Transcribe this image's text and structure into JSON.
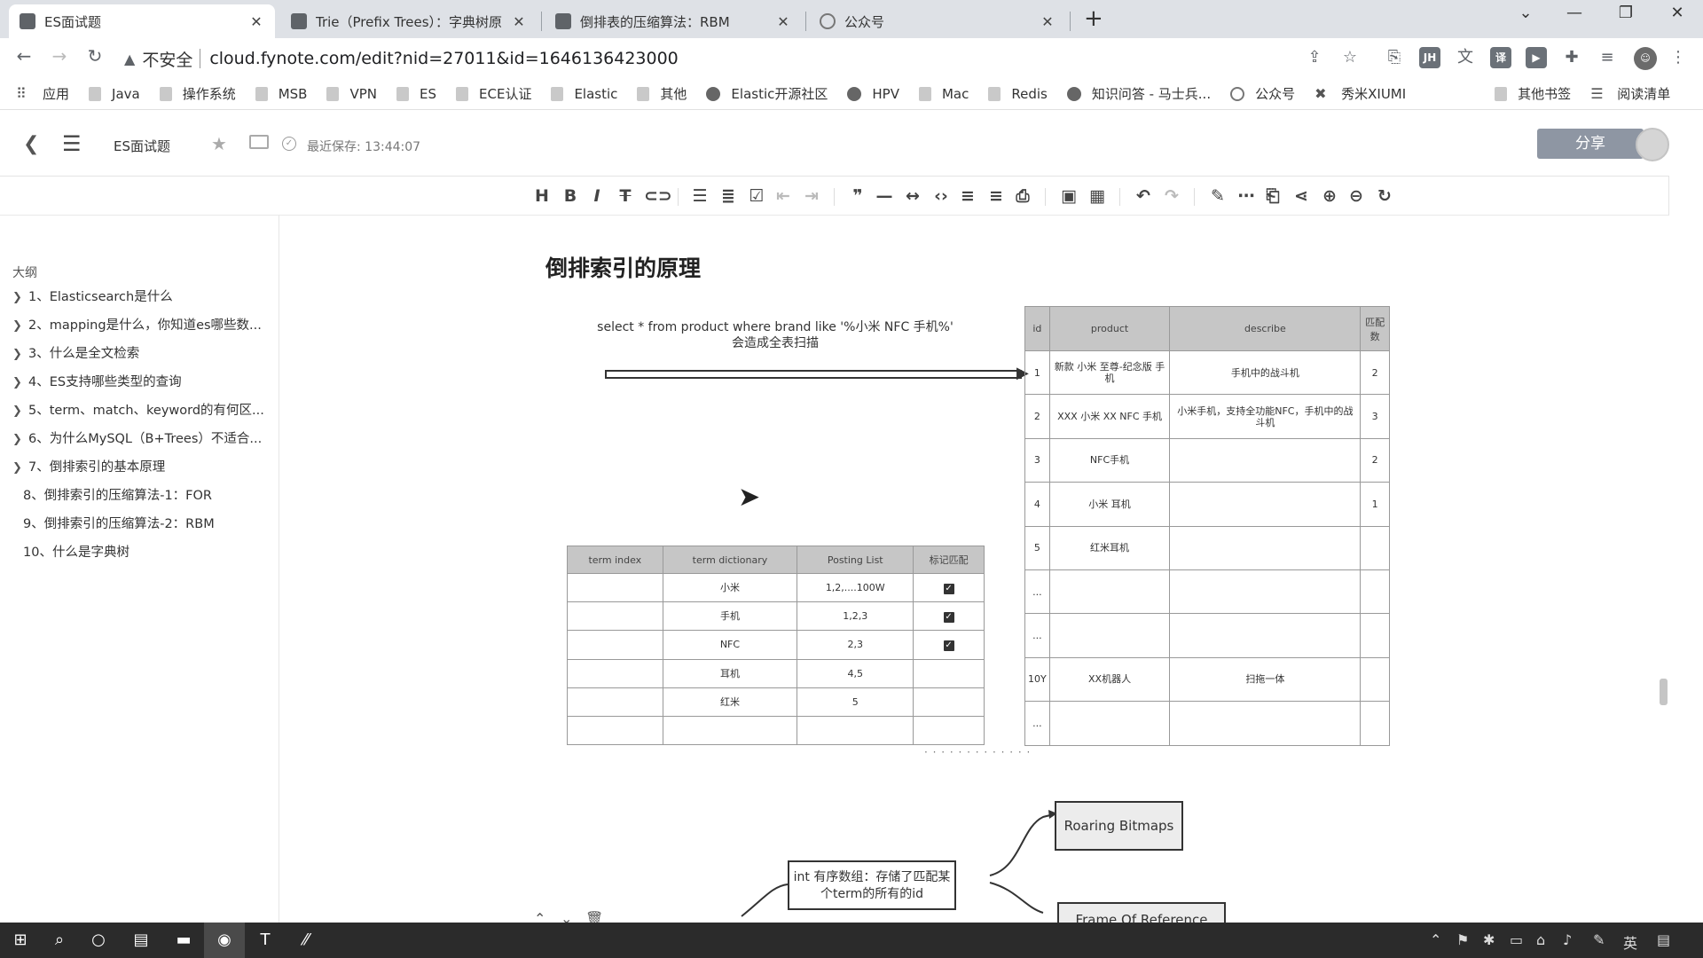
{
  "tabs": [
    {
      "title": "ES面试题",
      "active": true
    },
    {
      "title": "Trie（Prefix Trees）：字典树原",
      "active": false
    },
    {
      "title": "倒排表的压缩算法：RBM",
      "active": false
    },
    {
      "title": "公众号",
      "active": false
    }
  ],
  "address": {
    "insecure_label": "不安全",
    "url": "cloud.fynote.com/edit?nid=27011&id=1646136423000"
  },
  "bookmarks": [
    "应用",
    "Java",
    "操作系统",
    "MSB",
    "VPN",
    "ES",
    "ECE认证",
    "Elastic",
    "其他",
    "Elastic开源社区",
    "HPV",
    "Mac",
    "Redis",
    "知识问答 - 马士兵...",
    "公众号",
    "秀米XIUMI",
    "其他书签",
    "阅读清单"
  ],
  "header": {
    "doc_title": "ES面试题",
    "saved_label": "最近保存: 13:44:07",
    "share_label": "分享"
  },
  "outline": {
    "title": "大纲",
    "items": [
      {
        "label": "1、Elasticsearch是什么",
        "expandable": true
      },
      {
        "label": "2、mapping是什么，你知道es哪些数...",
        "expandable": true
      },
      {
        "label": "3、什么是全文检索",
        "expandable": true
      },
      {
        "label": "4、ES支持哪些类型的查询",
        "expandable": true
      },
      {
        "label": "5、term、match、keyword的有何区...",
        "expandable": true
      },
      {
        "label": "6、为什么MySQL（B+Trees）不适合...",
        "expandable": true
      },
      {
        "label": "7、倒排索引的基本原理",
        "expandable": true
      },
      {
        "label": "8、倒排索引的压缩算法-1：FOR",
        "expandable": false
      },
      {
        "label": "9、倒排索引的压缩算法-2：RBM",
        "expandable": false
      },
      {
        "label": "10、什么是字典树",
        "expandable": false
      }
    ]
  },
  "content": {
    "heading": "倒排索引的原理",
    "sql_line1": "select * from product where brand like '%小米 NFC 手机%'",
    "sql_line2": "会造成全表扫描",
    "product_table": {
      "headers": [
        "id",
        "product",
        "describe",
        "匹配数"
      ],
      "rows": [
        [
          "1",
          "新款 小米 至尊-纪念版 手机",
          "手机中的战斗机",
          "2"
        ],
        [
          "2",
          "XXX 小米 XX NFC 手机",
          "小米手机，支持全功能NFC，手机中的战斗机",
          "3"
        ],
        [
          "3",
          "NFC手机",
          "",
          "2"
        ],
        [
          "4",
          "小米 耳机",
          "",
          "1"
        ],
        [
          "5",
          "红米耳机",
          "",
          ""
        ],
        [
          "...",
          "",
          "",
          ""
        ],
        [
          "...",
          "",
          "",
          ""
        ],
        [
          "10Y",
          "XX机器人",
          "扫拖一体",
          ""
        ],
        [
          "...",
          "",
          "",
          ""
        ]
      ]
    },
    "term_table": {
      "headers": [
        "term index",
        "term dictionary",
        "Posting List",
        "标记匹配"
      ],
      "rows": [
        {
          "index": "",
          "term": "小米",
          "posting": "1,2,....100W",
          "checked": true
        },
        {
          "index": "",
          "term": "手机",
          "posting": "1,2,3",
          "checked": true
        },
        {
          "index": "",
          "term": "NFC",
          "posting": "2,3",
          "checked": true
        },
        {
          "index": "",
          "term": "耳机",
          "posting": "4,5",
          "checked": false
        },
        {
          "index": "",
          "term": "红米",
          "posting": "5",
          "checked": false
        },
        {
          "index": "",
          "term": "",
          "posting": "",
          "checked": false
        }
      ]
    },
    "mindmap": {
      "center": "int 有序数组：存储了匹配某个term的所有的id",
      "child1": "Roaring Bitmaps",
      "child2": "Frame Of Reference"
    }
  },
  "colors": {
    "share_button": "#8e96a3",
    "table_header": "#c6c6c6",
    "taskbar": "#2b2b2b"
  },
  "taskbar": {
    "lang": "英"
  }
}
